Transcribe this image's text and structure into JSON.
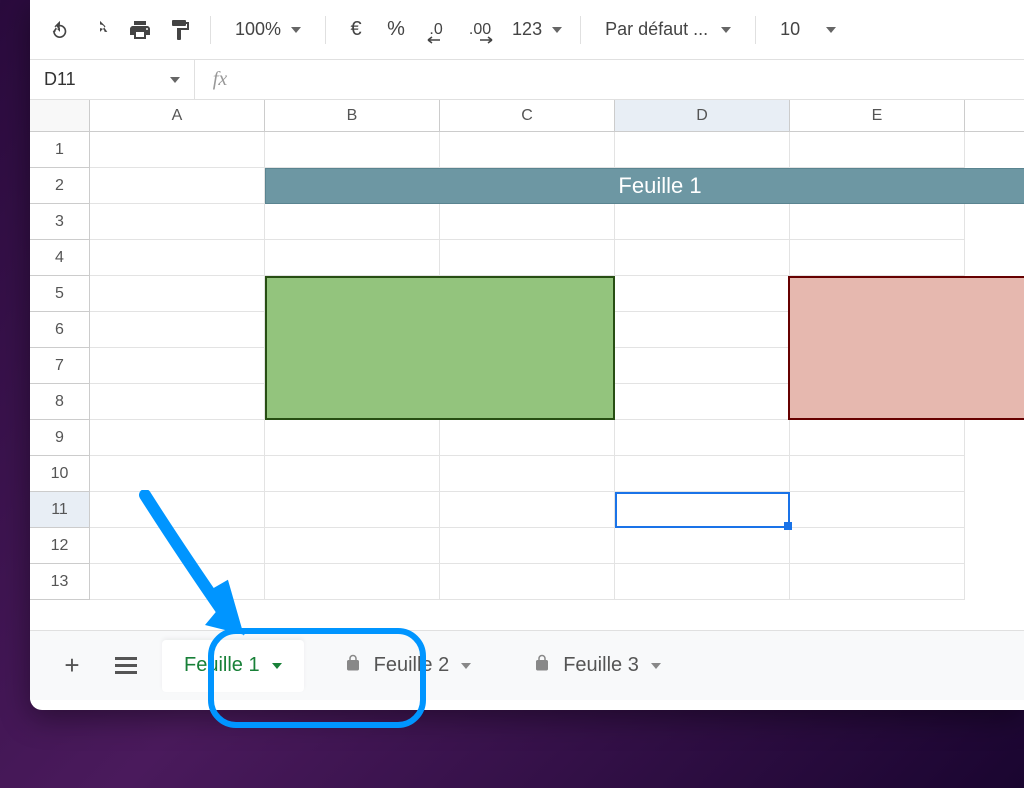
{
  "toolbar": {
    "zoom": "100%",
    "currency": "€",
    "percent": "%",
    "dec_decrease": ".0",
    "dec_increase": ".00",
    "num_format": "123",
    "font": "Par défaut ...",
    "font_size": "10"
  },
  "formula": {
    "name_box": "D11",
    "fx": "fx",
    "input_value": ""
  },
  "columns": [
    "A",
    "B",
    "C",
    "D",
    "E"
  ],
  "rows": [
    "1",
    "2",
    "3",
    "4",
    "5",
    "6",
    "7",
    "8",
    "9",
    "10",
    "11",
    "12",
    "13"
  ],
  "merged_title": "Feuille 1",
  "selected_cell": "D11",
  "sheets": {
    "add": "+",
    "tab1": "Feuille 1",
    "tab2": "Feuille 2",
    "tab3": "Feuille 3"
  },
  "colors": {
    "green_fill": "#93c47d",
    "green_border": "#274e13",
    "red_fill": "#e6b8af",
    "red_border": "#660000",
    "title_fill": "#6d97a3",
    "selection": "#1a73e8",
    "active_tab": "#188038",
    "annotation": "#0095ff"
  }
}
